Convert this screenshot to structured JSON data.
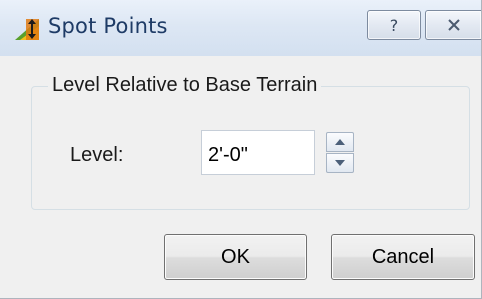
{
  "window": {
    "title": "Spot Points",
    "icon": "spot-points-app-icon",
    "caption_buttons": {
      "help_symbol": "?",
      "close_symbol": "X"
    }
  },
  "group": {
    "label": "Level Relative to Base Terrain"
  },
  "level": {
    "label": "Level:",
    "value": "2'-0\""
  },
  "buttons": {
    "ok": "OK",
    "cancel": "Cancel"
  },
  "colors": {
    "title_text": "#1e3b66",
    "dialog_bg": "#f0f0f0"
  }
}
